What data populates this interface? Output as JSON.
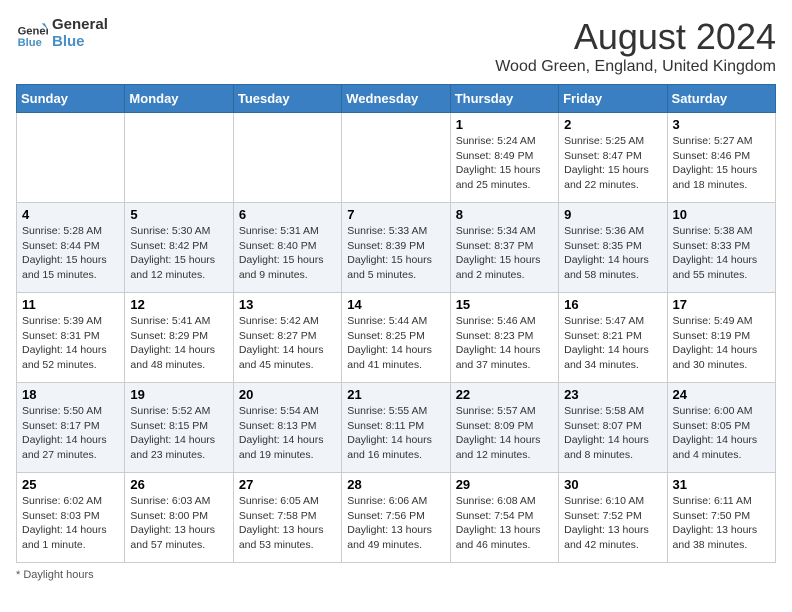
{
  "logo": {
    "line1": "General",
    "line2": "Blue"
  },
  "title": "August 2024",
  "subtitle": "Wood Green, England, United Kingdom",
  "days_of_week": [
    "Sunday",
    "Monday",
    "Tuesday",
    "Wednesday",
    "Thursday",
    "Friday",
    "Saturday"
  ],
  "weeks": [
    [
      {
        "day": "",
        "text": ""
      },
      {
        "day": "",
        "text": ""
      },
      {
        "day": "",
        "text": ""
      },
      {
        "day": "",
        "text": ""
      },
      {
        "day": "1",
        "text": "Sunrise: 5:24 AM\nSunset: 8:49 PM\nDaylight: 15 hours and 25 minutes."
      },
      {
        "day": "2",
        "text": "Sunrise: 5:25 AM\nSunset: 8:47 PM\nDaylight: 15 hours and 22 minutes."
      },
      {
        "day": "3",
        "text": "Sunrise: 5:27 AM\nSunset: 8:46 PM\nDaylight: 15 hours and 18 minutes."
      }
    ],
    [
      {
        "day": "4",
        "text": "Sunrise: 5:28 AM\nSunset: 8:44 PM\nDaylight: 15 hours and 15 minutes."
      },
      {
        "day": "5",
        "text": "Sunrise: 5:30 AM\nSunset: 8:42 PM\nDaylight: 15 hours and 12 minutes."
      },
      {
        "day": "6",
        "text": "Sunrise: 5:31 AM\nSunset: 8:40 PM\nDaylight: 15 hours and 9 minutes."
      },
      {
        "day": "7",
        "text": "Sunrise: 5:33 AM\nSunset: 8:39 PM\nDaylight: 15 hours and 5 minutes."
      },
      {
        "day": "8",
        "text": "Sunrise: 5:34 AM\nSunset: 8:37 PM\nDaylight: 15 hours and 2 minutes."
      },
      {
        "day": "9",
        "text": "Sunrise: 5:36 AM\nSunset: 8:35 PM\nDaylight: 14 hours and 58 minutes."
      },
      {
        "day": "10",
        "text": "Sunrise: 5:38 AM\nSunset: 8:33 PM\nDaylight: 14 hours and 55 minutes."
      }
    ],
    [
      {
        "day": "11",
        "text": "Sunrise: 5:39 AM\nSunset: 8:31 PM\nDaylight: 14 hours and 52 minutes."
      },
      {
        "day": "12",
        "text": "Sunrise: 5:41 AM\nSunset: 8:29 PM\nDaylight: 14 hours and 48 minutes."
      },
      {
        "day": "13",
        "text": "Sunrise: 5:42 AM\nSunset: 8:27 PM\nDaylight: 14 hours and 45 minutes."
      },
      {
        "day": "14",
        "text": "Sunrise: 5:44 AM\nSunset: 8:25 PM\nDaylight: 14 hours and 41 minutes."
      },
      {
        "day": "15",
        "text": "Sunrise: 5:46 AM\nSunset: 8:23 PM\nDaylight: 14 hours and 37 minutes."
      },
      {
        "day": "16",
        "text": "Sunrise: 5:47 AM\nSunset: 8:21 PM\nDaylight: 14 hours and 34 minutes."
      },
      {
        "day": "17",
        "text": "Sunrise: 5:49 AM\nSunset: 8:19 PM\nDaylight: 14 hours and 30 minutes."
      }
    ],
    [
      {
        "day": "18",
        "text": "Sunrise: 5:50 AM\nSunset: 8:17 PM\nDaylight: 14 hours and 27 minutes."
      },
      {
        "day": "19",
        "text": "Sunrise: 5:52 AM\nSunset: 8:15 PM\nDaylight: 14 hours and 23 minutes."
      },
      {
        "day": "20",
        "text": "Sunrise: 5:54 AM\nSunset: 8:13 PM\nDaylight: 14 hours and 19 minutes."
      },
      {
        "day": "21",
        "text": "Sunrise: 5:55 AM\nSunset: 8:11 PM\nDaylight: 14 hours and 16 minutes."
      },
      {
        "day": "22",
        "text": "Sunrise: 5:57 AM\nSunset: 8:09 PM\nDaylight: 14 hours and 12 minutes."
      },
      {
        "day": "23",
        "text": "Sunrise: 5:58 AM\nSunset: 8:07 PM\nDaylight: 14 hours and 8 minutes."
      },
      {
        "day": "24",
        "text": "Sunrise: 6:00 AM\nSunset: 8:05 PM\nDaylight: 14 hours and 4 minutes."
      }
    ],
    [
      {
        "day": "25",
        "text": "Sunrise: 6:02 AM\nSunset: 8:03 PM\nDaylight: 14 hours and 1 minute."
      },
      {
        "day": "26",
        "text": "Sunrise: 6:03 AM\nSunset: 8:00 PM\nDaylight: 13 hours and 57 minutes."
      },
      {
        "day": "27",
        "text": "Sunrise: 6:05 AM\nSunset: 7:58 PM\nDaylight: 13 hours and 53 minutes."
      },
      {
        "day": "28",
        "text": "Sunrise: 6:06 AM\nSunset: 7:56 PM\nDaylight: 13 hours and 49 minutes."
      },
      {
        "day": "29",
        "text": "Sunrise: 6:08 AM\nSunset: 7:54 PM\nDaylight: 13 hours and 46 minutes."
      },
      {
        "day": "30",
        "text": "Sunrise: 6:10 AM\nSunset: 7:52 PM\nDaylight: 13 hours and 42 minutes."
      },
      {
        "day": "31",
        "text": "Sunrise: 6:11 AM\nSunset: 7:50 PM\nDaylight: 13 hours and 38 minutes."
      }
    ]
  ],
  "legend_text": "Daylight hours"
}
